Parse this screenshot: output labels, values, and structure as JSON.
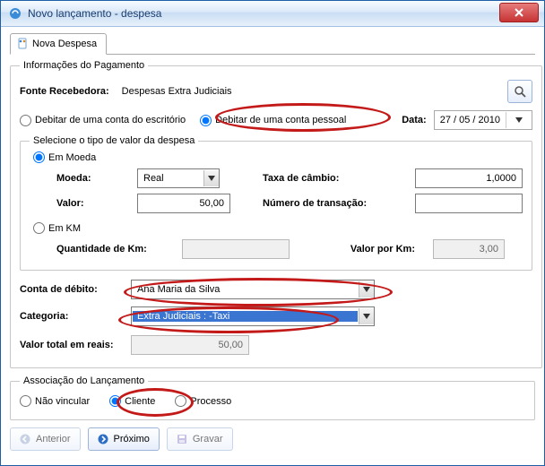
{
  "window": {
    "title": "Novo lançamento - despesa"
  },
  "tab": {
    "label": "Nova Despesa"
  },
  "group_payment": {
    "legend": "Informações do Pagamento"
  },
  "fonte": {
    "label": "Fonte Recebedora:",
    "value": "Despesas Extra Judiciais"
  },
  "debit": {
    "office": "Debitar de uma conta do escritório",
    "personal": "Debitar de uma conta pessoal"
  },
  "date": {
    "label": "Data:",
    "value": "27 / 05 / 2010"
  },
  "group_tipo": {
    "legend": "Selecione o tipo de valor da despesa",
    "em_moeda": "Em Moeda",
    "em_km": "Em KM"
  },
  "moeda": {
    "label": "Moeda:",
    "value": "Real",
    "taxa_label": "Taxa de câmbio:",
    "taxa_value": "1,0000",
    "valor_label": "Valor:",
    "valor_value": "50,00",
    "num_trans_label": "Número de transação:",
    "num_trans_value": ""
  },
  "km": {
    "qtd_label": "Quantidade de Km:",
    "qtd_value": "",
    "valor_label": "Valor por Km:",
    "valor_value": "3,00"
  },
  "conta": {
    "label": "Conta de débito:",
    "value": "Ana Maria da Silva"
  },
  "categoria": {
    "label": "Categoria:",
    "value": "Extra Judiciais : -Taxi"
  },
  "total": {
    "label": "Valor total em reais:",
    "value": "50,00"
  },
  "group_assoc": {
    "legend": "Associação do Lançamento",
    "nao": "Não vincular",
    "cliente": "Cliente",
    "processo": "Processo"
  },
  "buttons": {
    "anterior": "Anterior",
    "proximo": "Próximo",
    "gravar": "Gravar"
  }
}
